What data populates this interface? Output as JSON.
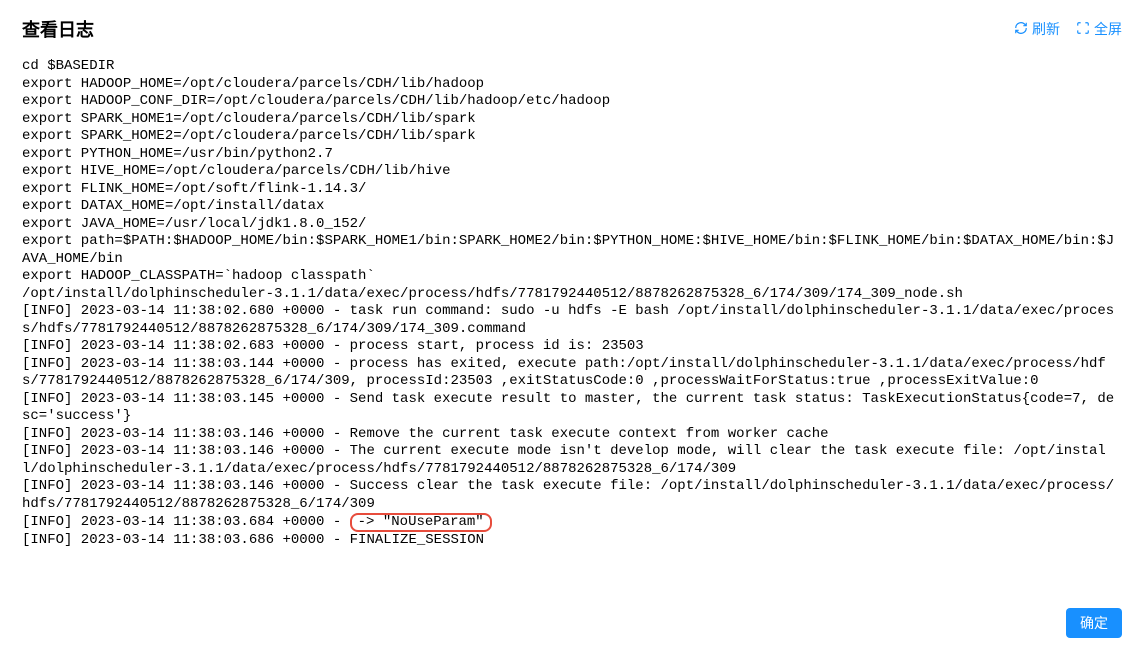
{
  "header": {
    "title": "查看日志",
    "refresh_label": "刷新",
    "fullscreen_label": "全屏"
  },
  "log": {
    "lines": [
      "cd $BASEDIR",
      "export HADOOP_HOME=/opt/cloudera/parcels/CDH/lib/hadoop",
      "export HADOOP_CONF_DIR=/opt/cloudera/parcels/CDH/lib/hadoop/etc/hadoop",
      "export SPARK_HOME1=/opt/cloudera/parcels/CDH/lib/spark",
      "export SPARK_HOME2=/opt/cloudera/parcels/CDH/lib/spark",
      "export PYTHON_HOME=/usr/bin/python2.7",
      "export HIVE_HOME=/opt/cloudera/parcels/CDH/lib/hive",
      "export FLINK_HOME=/opt/soft/flink-1.14.3/",
      "export DATAX_HOME=/opt/install/datax",
      "export JAVA_HOME=/usr/local/jdk1.8.0_152/",
      "export path=$PATH:$HADOOP_HOME/bin:$SPARK_HOME1/bin:SPARK_HOME2/bin:$PYTHON_HOME:$HIVE_HOME/bin:$FLINK_HOME/bin:$DATAX_HOME/bin:$JAVA_HOME/bin",
      "export HADOOP_CLASSPATH=`hadoop classpath`",
      "/opt/install/dolphinscheduler-3.1.1/data/exec/process/hdfs/7781792440512/8878262875328_6/174/309/174_309_node.sh",
      "[INFO] 2023-03-14 11:38:02.680 +0000 - task run command: sudo -u hdfs -E bash /opt/install/dolphinscheduler-3.1.1/data/exec/process/hdfs/7781792440512/8878262875328_6/174/309/174_309.command",
      "[INFO] 2023-03-14 11:38:02.683 +0000 - process start, process id is: 23503",
      "[INFO] 2023-03-14 11:38:03.144 +0000 - process has exited, execute path:/opt/install/dolphinscheduler-3.1.1/data/exec/process/hdfs/7781792440512/8878262875328_6/174/309, processId:23503 ,exitStatusCode:0 ,processWaitForStatus:true ,processExitValue:0",
      "[INFO] 2023-03-14 11:38:03.145 +0000 - Send task execute result to master, the current task status: TaskExecutionStatus{code=7, desc='success'}",
      "[INFO] 2023-03-14 11:38:03.146 +0000 - Remove the current task execute context from worker cache",
      "[INFO] 2023-03-14 11:38:03.146 +0000 - The current execute mode isn't develop mode, will clear the task execute file: /opt/install/dolphinscheduler-3.1.1/data/exec/process/hdfs/7781792440512/8878262875328_6/174/309",
      "[INFO] 2023-03-14 11:38:03.146 +0000 - Success clear the task execute file: /opt/install/dolphinscheduler-3.1.1/data/exec/process/hdfs/7781792440512/8878262875328_6/174/309"
    ],
    "highlighted_line_prefix": "[INFO] 2023-03-14 11:38:03.684 +0000 - ",
    "highlighted_text": "-> \"NoUseParam\"",
    "final_line": "[INFO] 2023-03-14 11:38:03.686 +0000 - FINALIZE_SESSION"
  },
  "footer": {
    "confirm_label": "确定"
  }
}
